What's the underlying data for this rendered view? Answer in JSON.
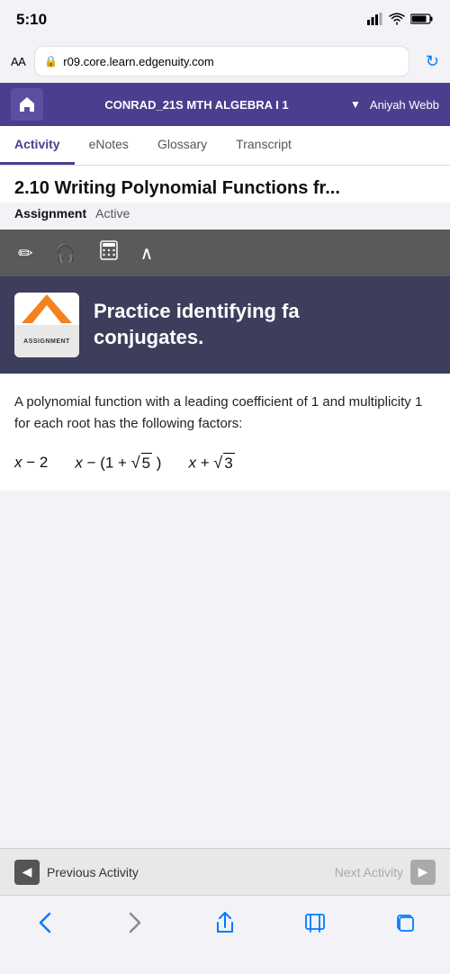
{
  "status_bar": {
    "time": "5:10"
  },
  "browser": {
    "font_label": "AA",
    "url": "r09.core.learn.edgenuity.com",
    "refresh_icon": "↻"
  },
  "nav_header": {
    "home_icon": "🏠",
    "course_title": "CONRAD_21S MTH ALGEBRA I 1",
    "dropdown_label": "▼",
    "user_name": "Aniyah Webb"
  },
  "tabs": [
    {
      "label": "Activity",
      "active": true
    },
    {
      "label": "eNotes",
      "active": false
    },
    {
      "label": "Glossary",
      "active": false
    },
    {
      "label": "Transcript",
      "active": false
    }
  ],
  "page_title": "2.10 Writing Polynomial Functions fr...",
  "assignment": {
    "label": "Assignment",
    "status": "Active"
  },
  "toolbar": {
    "icons": [
      "✏️",
      "🎧",
      "⊞",
      "∧"
    ]
  },
  "banner": {
    "logo_text": "ASSIGNMENT",
    "heading_part1": "Practice identifying fa",
    "heading_part2": "conjugates."
  },
  "problem": {
    "description": "A polynomial function with a leading coefficient of 1 and multiplicity 1 for each root has the following factors:",
    "factors": [
      {
        "text": "x − 2"
      },
      {
        "text": "x − (1 + √5)"
      },
      {
        "text": "x + √3"
      }
    ]
  },
  "bottom_nav": {
    "prev_label": "Previous Activity",
    "next_label": "Next Activity",
    "prev_arrow": "◀",
    "next_arrow": "▶"
  },
  "ios_bar": {
    "back": "‹",
    "forward": "›",
    "share": "⬆",
    "bookmark": "📖",
    "tabs": "⧉"
  }
}
